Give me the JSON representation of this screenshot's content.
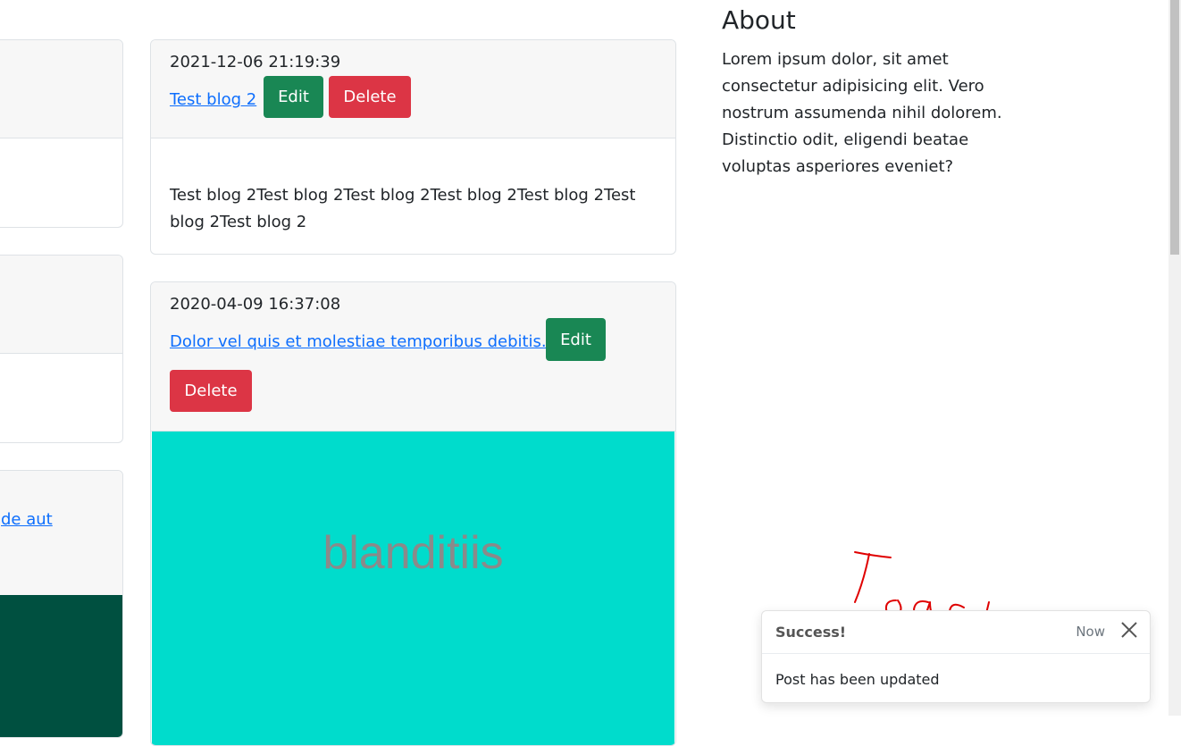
{
  "left_column": {
    "partial_link": "de aut"
  },
  "posts": [
    {
      "timestamp": "2021-12-06 21:19:39",
      "title": "Test blog 2",
      "edit_label": "Edit",
      "delete_label": "Delete",
      "body": "Test blog 2Test blog 2Test blog 2Test blog 2Test blog 2Test blog 2Test blog 2"
    },
    {
      "timestamp": "2020-04-09 16:37:08",
      "title": "Dolor vel quis et molestiae temporibus debitis.",
      "edit_label": "Edit",
      "delete_label": "Delete",
      "image_text": "blanditiis",
      "image_color": "#00dccc"
    }
  ],
  "sidebar": {
    "title": "About",
    "text": "Lorem ipsum dolor, sit amet consectetur adipisicing elit. Vero nostrum assumenda nihil dolorem. Distinctio odit, eligendi beatae voluptas asperiores eveniet?"
  },
  "toast": {
    "title": "Success!",
    "time": "Now",
    "message": "Post has been updated",
    "close_icon": "close-icon"
  },
  "annotation": {
    "text": "Toast",
    "color": "#e00000"
  },
  "colors": {
    "edit": "#198754",
    "delete": "#dc3545",
    "link": "#0d6efd",
    "dark_image": "#005040"
  }
}
